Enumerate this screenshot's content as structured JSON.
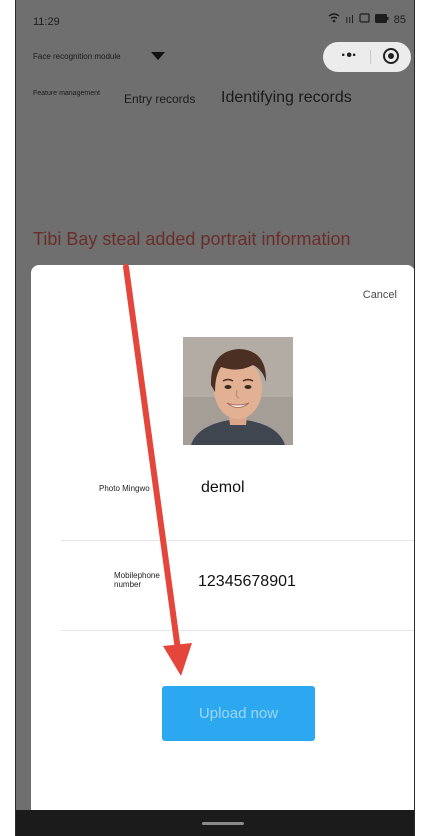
{
  "status_bar": {
    "time": "11:29",
    "signal_text": "ııl",
    "battery": "85"
  },
  "header": {
    "module_title": "Face recognition module",
    "more_icon": "more-dots-icon",
    "close_icon": "target-circle-icon"
  },
  "tabs": {
    "feature_management": "Feature management",
    "entry_records": "Entry records",
    "identifying_records": "Identifying records"
  },
  "banner_text": "Tibi Bay steal added portrait information",
  "sheet": {
    "cancel_label": "Cancel",
    "name_label": "Photo Mingwo",
    "name_value": "demol",
    "phone_label": "Mobilephone number",
    "phone_value": "12345678901",
    "upload_label": "Upload now"
  },
  "colors": {
    "accent": "#2ba8f0",
    "annotation_arrow": "#e4463b",
    "banner_text": "#6a2e2a"
  }
}
